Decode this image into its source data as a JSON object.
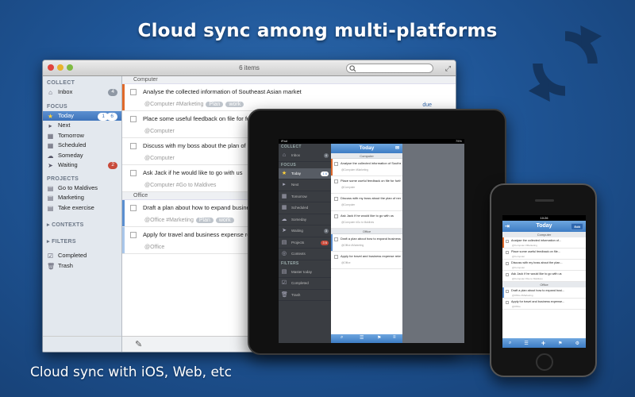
{
  "headline": "Cloud sync among multi-platforms",
  "subline": "Cloud sync with iOS, Web, etc",
  "colors": {
    "accent": "#3d73ba",
    "orange": "#e06a2b",
    "blue_mark": "#5b8fd0",
    "red_badge": "#c84a3a"
  },
  "mac": {
    "title": "6 items",
    "sidebar": {
      "collect_header": "COLLECT",
      "inbox": {
        "label": "Inbox",
        "count": "4"
      },
      "focus_header": "FOCUS",
      "focus_items": [
        {
          "label": "Today",
          "badge_a": "1",
          "badge_b": "6",
          "icon": "star-icon"
        },
        {
          "label": "Next",
          "icon": "arrow-icon"
        },
        {
          "label": "Tomorrow",
          "icon": "calendar-icon"
        },
        {
          "label": "Scheduled",
          "icon": "calendar-icon"
        },
        {
          "label": "Someday",
          "icon": "cloud-icon"
        },
        {
          "label": "Waiting",
          "badge": "2",
          "icon": "send-icon"
        }
      ],
      "projects_header": "PROJECTS",
      "projects": [
        "Go to Maldives",
        "Marketing",
        "Take exercise"
      ],
      "contexts_header": "CONTEXTS",
      "filters_header": "FILTERS",
      "bottom_items": [
        "Completed",
        "Trash"
      ]
    },
    "groups": {
      "computer": "Computer",
      "office": "Office"
    },
    "tasks_computer": [
      {
        "title": "Analyse the collected information of Southeast Asian market",
        "meta": "@Computer   #Marketing",
        "tags": [
          "Plan",
          "work"
        ],
        "due": "due"
      },
      {
        "title": "Place some useful feedback on file for fur",
        "meta": "@Computer"
      },
      {
        "title": "Discuss with my boss about the plan of n",
        "meta": "@Computer"
      },
      {
        "title": "Ask Jack if he would like to go with us",
        "meta": "@Computer   #Go to Maldives"
      }
    ],
    "tasks_office": [
      {
        "title": "Draft a plan about how to expand busine",
        "meta": "@Office   #Marketing",
        "tags": [
          "Plan",
          "work"
        ]
      },
      {
        "title": "Apply for travel and business expense re",
        "meta": "@Office"
      }
    ]
  },
  "ipad": {
    "status_left": "iPad",
    "status_right": "75%",
    "title": "Today",
    "sidebar": {
      "collect_header": "COLLECT",
      "inbox": {
        "label": "Inbox",
        "count": "4"
      },
      "focus_header": "FOCUS",
      "items": [
        {
          "label": "Today",
          "badge": "1 6"
        },
        {
          "label": "Next"
        },
        {
          "label": "Tomorrow"
        },
        {
          "label": "Scheduled"
        },
        {
          "label": "Someday"
        },
        {
          "label": "Waiting",
          "badge": "3"
        },
        {
          "label": "Projects",
          "badge": "3 6"
        },
        {
          "label": "Contexts"
        }
      ],
      "filters_header": "FILTERS",
      "filters": [
        "Master today",
        "Completed",
        "Trash"
      ]
    },
    "groups": {
      "computer": "Computer",
      "office": "Office"
    },
    "tasks_computer": [
      {
        "title": "Analyse the collected information of Southeast Asian market",
        "meta": "@Computer   #Marketing"
      },
      {
        "title": "Place some useful feedback on file for further references",
        "meta": "@Computer"
      },
      {
        "title": "Discuss with my boss about the plan of next month",
        "meta": "@Computer"
      },
      {
        "title": "Ask Jack if he would like to go with us",
        "meta": "@Computer   #Go to Maldives"
      }
    ],
    "tasks_office": [
      {
        "title": "Draft a plan about how to expand business in Southeast Asi",
        "meta": "@Office   #Marketing"
      },
      {
        "title": "Apply for travel and business expense reimbursement",
        "meta": "@Office"
      }
    ]
  },
  "iphone": {
    "time": "10:26",
    "title": "Today",
    "edit": "Edit",
    "groups": {
      "computer": "Computer",
      "office": "Office"
    },
    "tasks_computer": [
      {
        "title": "Analyse the collected information of...",
        "meta": "@Computer  #Marketing"
      },
      {
        "title": "Place some useful feedback on file...",
        "meta": "@Computer"
      },
      {
        "title": "Discuss with my boss about the plan...",
        "meta": "@Computer"
      },
      {
        "title": "Ask Jack if he would like to go with us",
        "meta": "@Computer  #Go to Maldives"
      }
    ],
    "tasks_office": [
      {
        "title": "Draft a plan about how to expand busi...",
        "meta": "@Office  #Marketing"
      },
      {
        "title": "Apply for travel and business expense...",
        "meta": "@Office"
      }
    ]
  }
}
